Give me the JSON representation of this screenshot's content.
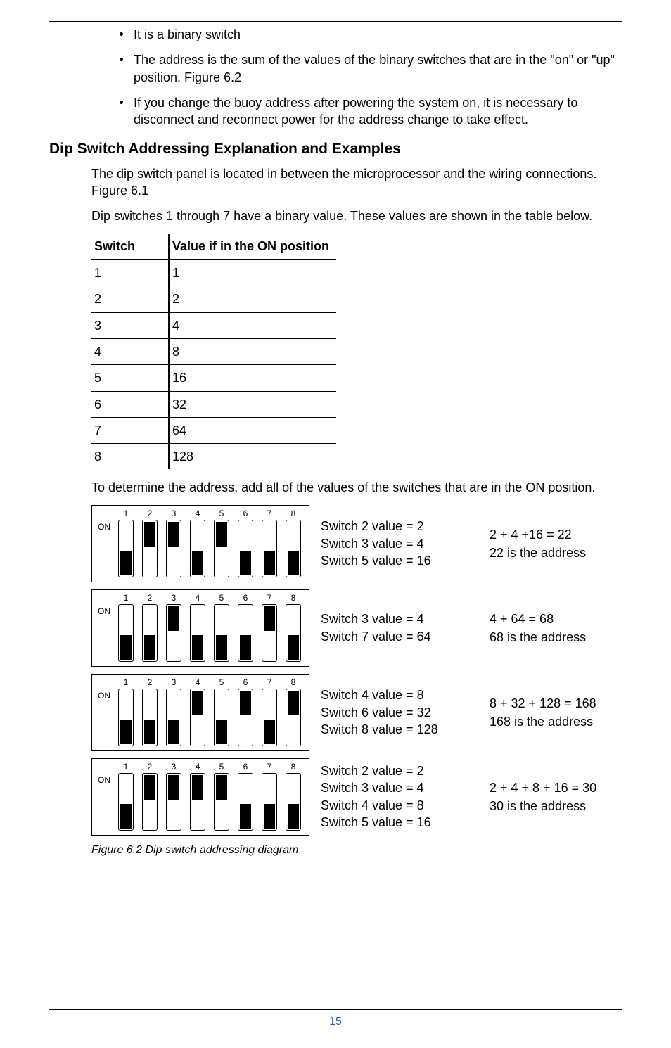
{
  "bullets": [
    "It is a binary switch",
    "The address is the sum of the values of the binary switches that are in the \"on\" or \"up\" position. Figure 6.2",
    "If you change the buoy address after powering the system on, it is necessary to disconnect and reconnect power for the address change to take effect."
  ],
  "section_heading": "Dip Switch Addressing Explanation and Examples",
  "para1": "The dip switch panel is located in between the microprocessor and the wiring connections. Figure 6.1",
  "para2": "Dip switches 1 through 7 have a binary value. These values are shown in the table below.",
  "table": {
    "head_switch": "Switch",
    "head_value": "Value if in the ON position",
    "rows": [
      {
        "s": "1",
        "v": "1"
      },
      {
        "s": "2",
        "v": "2"
      },
      {
        "s": "3",
        "v": "4"
      },
      {
        "s": "4",
        "v": "8"
      },
      {
        "s": "5",
        "v": "16"
      },
      {
        "s": "6",
        "v": "32"
      },
      {
        "s": "7",
        "v": "64"
      },
      {
        "s": "8",
        "v": "128"
      }
    ]
  },
  "para3": "To determine the address, add all of the values of the switches that are in the ON position.",
  "dip": {
    "on_label": "ON",
    "nums": [
      "1",
      "2",
      "3",
      "4",
      "5",
      "6",
      "7",
      "8"
    ],
    "rows": [
      {
        "up": [
          2,
          3,
          5
        ],
        "explain": [
          "Switch 2 value = 2",
          "Switch 3 value = 4",
          "Switch 5 value = 16"
        ],
        "result": [
          "2 + 4 +16 = 22",
          "22 is the address"
        ]
      },
      {
        "up": [
          3,
          7
        ],
        "explain": [
          "Switch 3 value = 4",
          "Switch 7 value = 64"
        ],
        "result": [
          "4 + 64 = 68",
          "68 is the address"
        ]
      },
      {
        "up": [
          4,
          6,
          8
        ],
        "explain": [
          "Switch 4 value = 8",
          "Switch 6 value = 32",
          "Switch 8 value = 128"
        ],
        "result": [
          "8 + 32 + 128 = 168",
          "168 is the address"
        ]
      },
      {
        "up": [
          2,
          3,
          4,
          5
        ],
        "explain": [
          "Switch 2 value = 2",
          "Switch 3 value = 4",
          "Switch 4 value = 8",
          "Switch 5 value = 16"
        ],
        "result": [
          "2 + 4 + 8 + 16 = 30",
          "30 is the address"
        ]
      }
    ]
  },
  "caption": "Figure 6.2 Dip switch addressing diagram",
  "page_number": "15",
  "chart_data": {
    "type": "table",
    "title": "Dip switch binary values",
    "columns": [
      "Switch",
      "Value if in the ON position"
    ],
    "rows": [
      [
        1,
        1
      ],
      [
        2,
        2
      ],
      [
        3,
        4
      ],
      [
        4,
        8
      ],
      [
        5,
        16
      ],
      [
        6,
        32
      ],
      [
        7,
        64
      ],
      [
        8,
        128
      ]
    ]
  }
}
